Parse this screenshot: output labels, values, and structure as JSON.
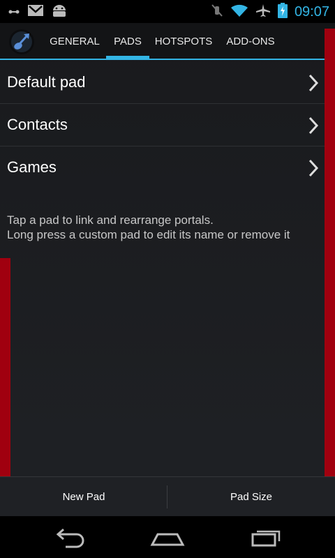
{
  "status_bar": {
    "time": "09:07",
    "icons": [
      "usb-debug-icon",
      "gmail-icon",
      "android-icon",
      "mute-icon",
      "wifi-icon",
      "airplane-icon",
      "battery-charging-icon"
    ]
  },
  "action_bar": {
    "tabs": [
      {
        "label": "GENERAL"
      },
      {
        "label": "PADS"
      },
      {
        "label": "HOTSPOTS"
      },
      {
        "label": "ADD-ONS"
      }
    ],
    "active_tab": "PADS"
  },
  "pads": [
    {
      "label": "Default pad"
    },
    {
      "label": "Contacts"
    },
    {
      "label": "Games"
    }
  ],
  "help": {
    "line1": "Tap a pad to link and rearrange portals.",
    "line2": "Long press a custom pad to edit its name or remove it"
  },
  "bottom_bar": {
    "new_pad": "New Pad",
    "pad_size": "Pad Size"
  },
  "colors": {
    "accent": "#33b5e5",
    "edge_bar": "#a0000f"
  }
}
